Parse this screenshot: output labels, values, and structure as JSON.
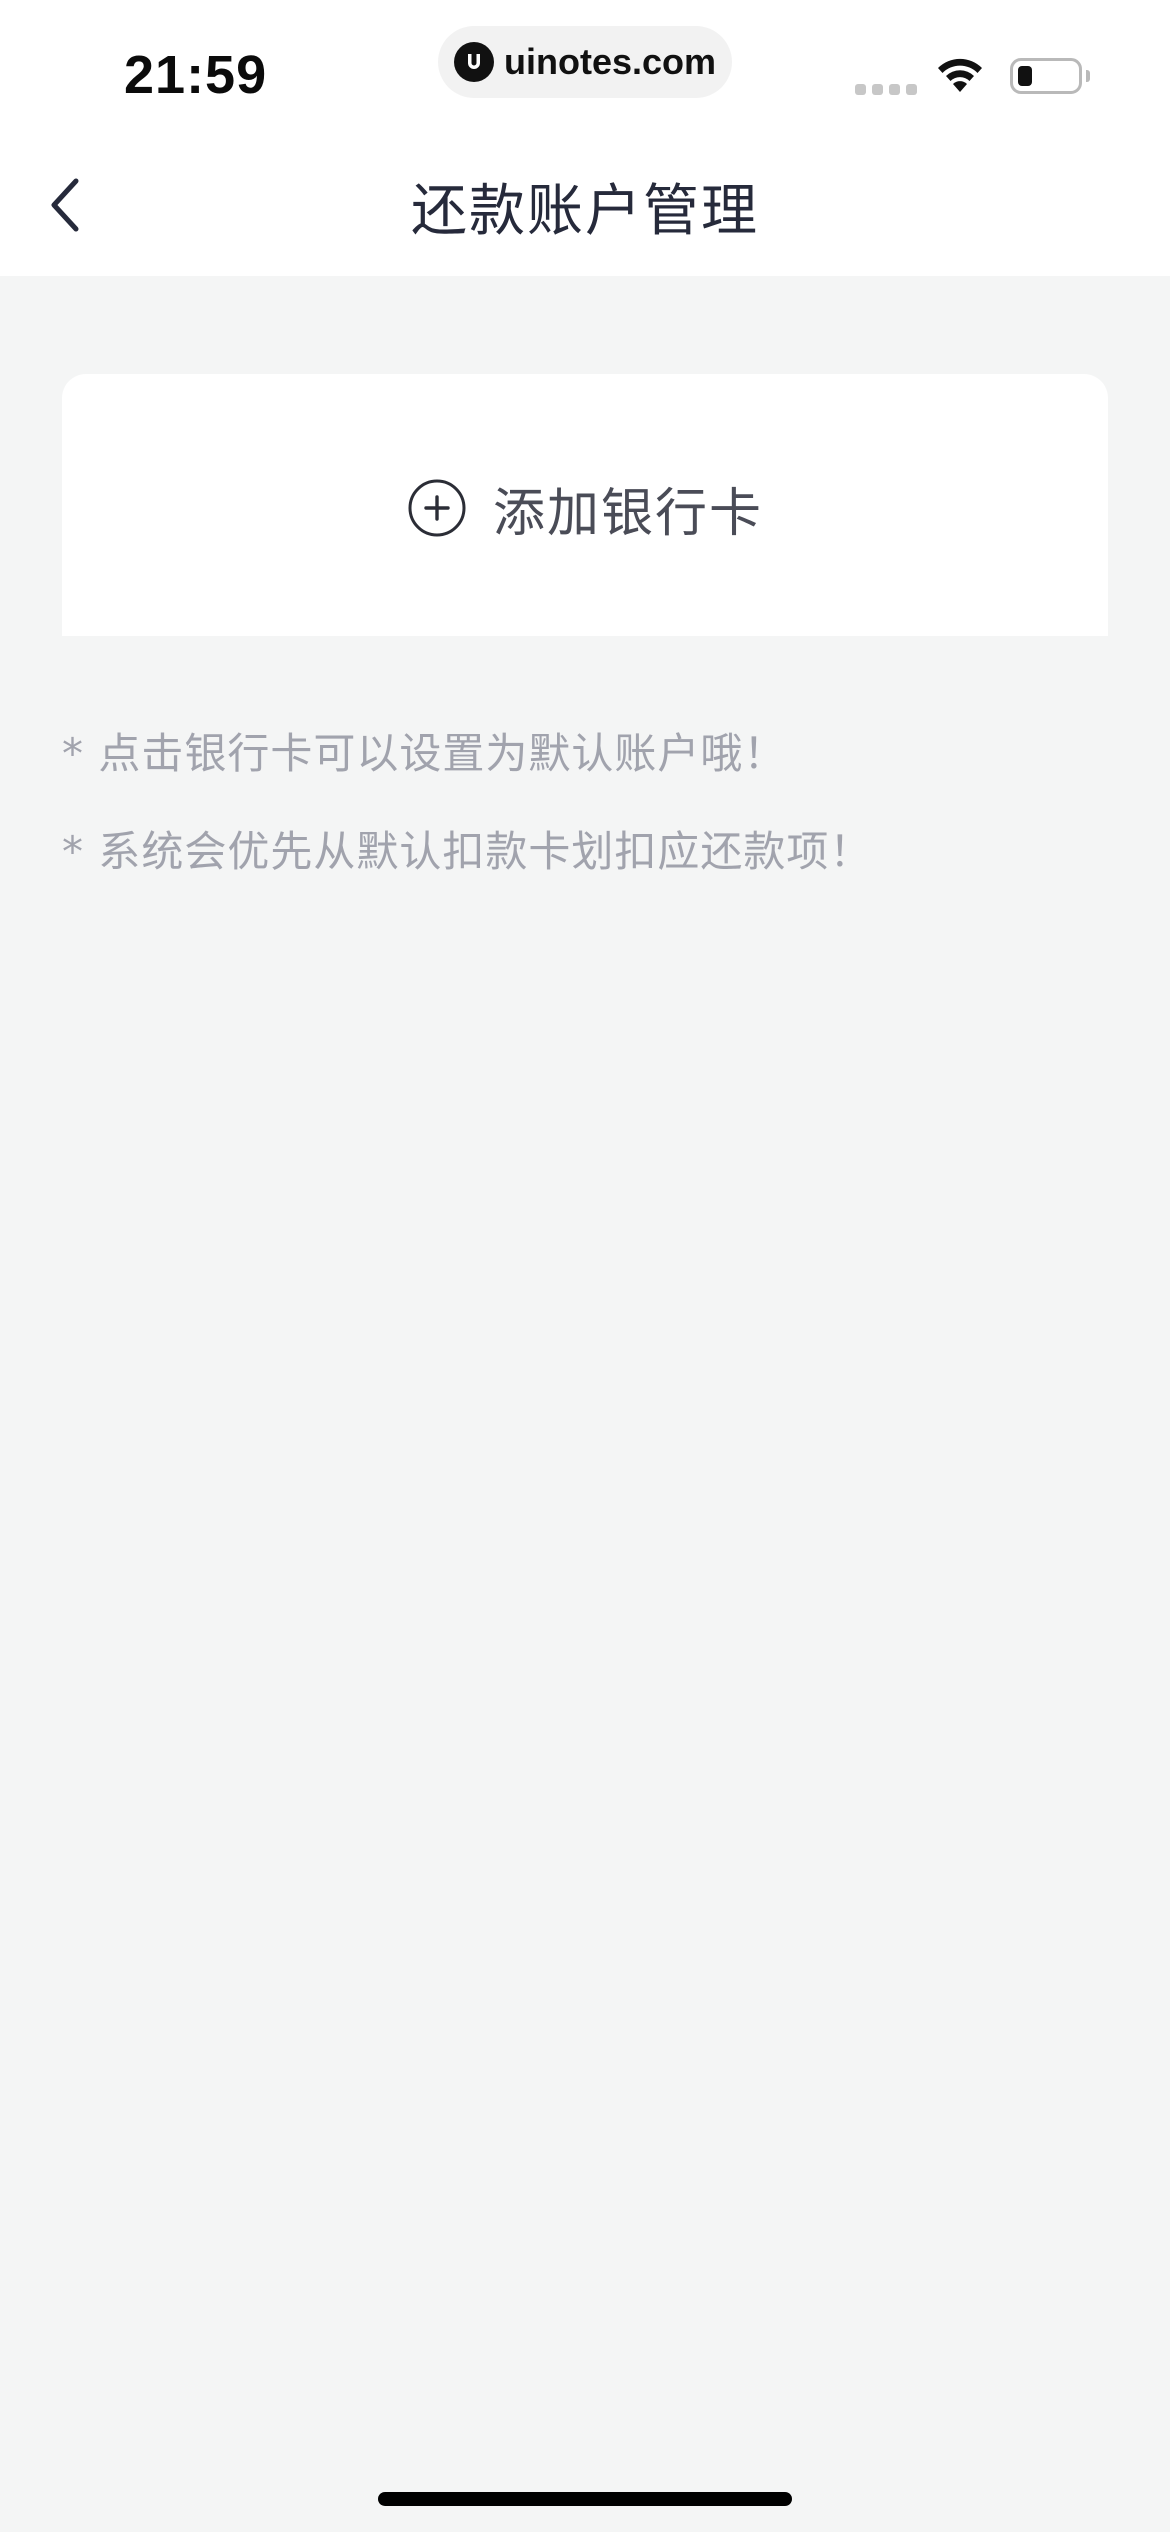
{
  "status_bar": {
    "time": "21:59",
    "url": "uinotes.com",
    "icons": [
      "signal-icon",
      "wifi-icon",
      "battery-icon"
    ]
  },
  "nav": {
    "back_icon": "chevron-left-icon",
    "title": "还款账户管理"
  },
  "add_card": {
    "icon": "plus-circle-icon",
    "label": "添加银行卡"
  },
  "notes": [
    "* 点击银行卡可以设置为默认账户哦！",
    "* 系统会优先从默认扣款卡划扣应还款项！"
  ],
  "colors": {
    "background": "#f4f5f5",
    "card": "#ffffff",
    "title": "#262a3b",
    "note": "#a1a3ad"
  }
}
